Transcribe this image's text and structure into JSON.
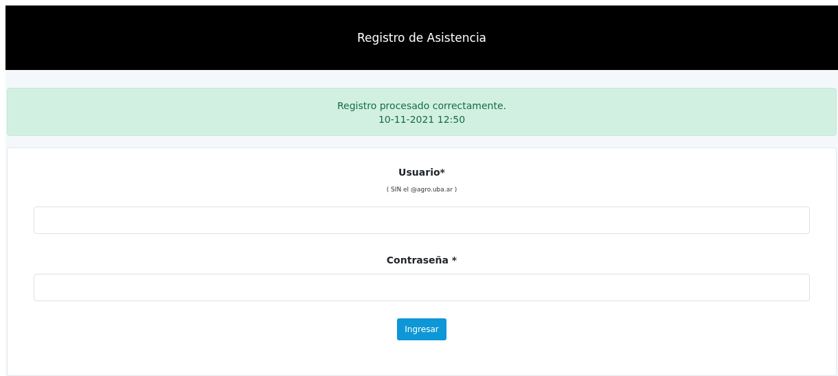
{
  "header": {
    "title": "Registro de Asistencia"
  },
  "alert": {
    "message": "Registro procesado correctamente.",
    "timestamp": "10-11-2021 12:50"
  },
  "form": {
    "fields": [
      {
        "label": "Usuario*",
        "hint": "( SIN el @agro.uba.ar )"
      },
      {
        "label": "Contraseña *"
      }
    ],
    "submit": "Ingresar"
  }
}
